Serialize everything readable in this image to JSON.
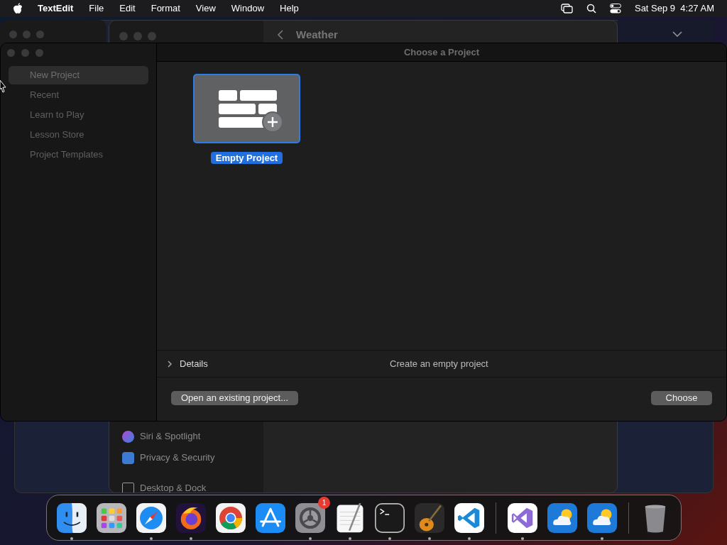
{
  "menu_bar": {
    "app": "TextEdit",
    "menus": [
      "File",
      "Edit",
      "Format",
      "View",
      "Window",
      "Help"
    ],
    "clock": "Sat Sep 9  4:27 AM"
  },
  "background": {
    "weather_title": "Weather",
    "settings_items": [
      "Siri & Spotlight",
      "Privacy & Security",
      "Desktop & Dock"
    ]
  },
  "dialog": {
    "title": "Choose a Project",
    "sidebar": [
      {
        "label": "New Project",
        "selected": true
      },
      {
        "label": "Recent",
        "selected": false
      },
      {
        "label": "Learn to Play",
        "selected": false
      },
      {
        "label": "Lesson Store",
        "selected": false
      },
      {
        "label": "Project Templates",
        "selected": false
      }
    ],
    "templates": [
      {
        "label": "Empty Project",
        "selected": true
      }
    ],
    "details": {
      "label": "Details",
      "expanded": false,
      "description": "Create an empty project"
    },
    "open_button": "Open an existing project...",
    "choose_button": "Choose"
  },
  "dock": [
    {
      "kind": "finder",
      "running": true
    },
    {
      "kind": "launchpad",
      "running": false
    },
    {
      "kind": "safari",
      "running": true
    },
    {
      "kind": "firefox",
      "running": true
    },
    {
      "kind": "chrome",
      "running": false
    },
    {
      "kind": "appstore",
      "running": false
    },
    {
      "kind": "settings",
      "running": true,
      "badge": "1"
    },
    {
      "kind": "textedit",
      "running": true
    },
    {
      "kind": "terminal",
      "running": true
    },
    {
      "kind": "garageband",
      "running": true
    },
    {
      "kind": "vscode",
      "running": true
    },
    {
      "kind": "separator"
    },
    {
      "kind": "visualstudio",
      "running": true
    },
    {
      "kind": "weather",
      "running": false
    },
    {
      "kind": "weather",
      "running": true
    },
    {
      "kind": "separator"
    },
    {
      "kind": "trash",
      "running": false
    }
  ]
}
